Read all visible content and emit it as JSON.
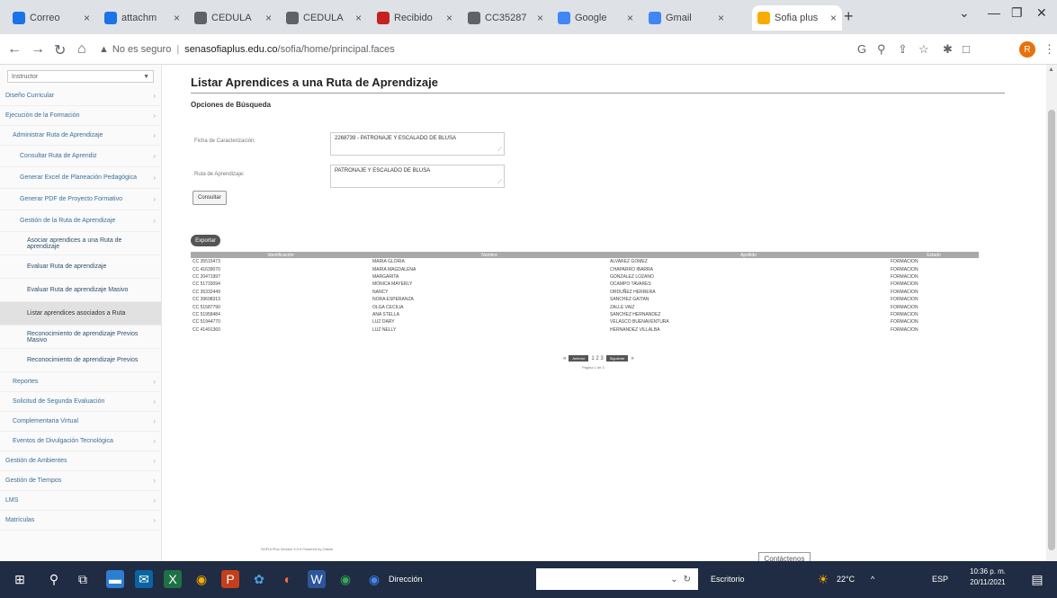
{
  "browser": {
    "tabs": [
      {
        "label": "Correo",
        "color": "#1a73e8"
      },
      {
        "label": "attachm",
        "color": "#1a73e8"
      },
      {
        "label": "CEDULA",
        "color": "#5f6368"
      },
      {
        "label": "CEDULA",
        "color": "#5f6368"
      },
      {
        "label": "Recibido",
        "color": "#c5221f"
      },
      {
        "label": "CC35287",
        "color": "#5f6368"
      },
      {
        "label": "Google",
        "color": "#4285f4"
      },
      {
        "label": "Gmail",
        "color": "#4285f4"
      },
      {
        "label": "Sofia plus",
        "color": "#f9ab00"
      }
    ],
    "url_warning": "No es seguro",
    "url_host": "senasofiaplus.edu.co",
    "url_path": "/sofia/home/principal.faces"
  },
  "sidebar": {
    "select": "Instructor",
    "items": [
      {
        "label": "Diseño Curricular",
        "level": 0
      },
      {
        "label": "Ejecución de la Formación",
        "level": 0
      },
      {
        "label": "Administrar Ruta de Aprendizaje",
        "level": 1
      },
      {
        "label": "Consultar Ruta de Aprendiz",
        "level": 2
      },
      {
        "label": "Generar Excel de Planeación Pedagógica",
        "level": 2
      },
      {
        "label": "Generar PDF de Proyecto Formativo",
        "level": 2
      },
      {
        "label": "Gestión de la Ruta de Aprendizaje",
        "level": 2
      },
      {
        "label": "Asociar aprendices a una Ruta de aprendizaje",
        "level": 3
      },
      {
        "label": "Evaluar Ruta de aprendizaje",
        "level": 3
      },
      {
        "label": "Evaluar Ruta de aprendizaje Masivo",
        "level": 3
      },
      {
        "label": "Listar aprendices asociados a Ruta",
        "level": 3,
        "active": true
      },
      {
        "label": "Reconocimiento de aprendizaje Previos Masivo",
        "level": 3
      },
      {
        "label": "Reconocimiento de aprendizaje Previos",
        "level": 3
      },
      {
        "label": "Reportes",
        "level": 1
      },
      {
        "label": "Solicitud de Segunda Evaluación",
        "level": 1
      },
      {
        "label": "Complementaria Virtual",
        "level": 1
      },
      {
        "label": "Eventos de Divulgación Tecnológica",
        "level": 1
      },
      {
        "label": "Gestión de Ambientes",
        "level": 0
      },
      {
        "label": "Gestión de Tiempos",
        "level": 0
      },
      {
        "label": "LMS",
        "level": 0
      },
      {
        "label": "Matrículas",
        "level": 0
      }
    ]
  },
  "main": {
    "title": "Listar Aprendices a una Ruta de Aprendizaje",
    "section": "Opciones de Búsqueda",
    "ficha_label": "Ficha de Caracterización:",
    "ficha_value": "2268739 - PATRONAJE Y ESCALADO DE BLUSA",
    "ruta_label": "Ruta de Aprendizaje:",
    "ruta_value": "PATRONAJE Y ESCALADO DE BLUSA",
    "consult_button": "Consultar",
    "export_button": "Exportar",
    "columns": [
      "Identificación",
      "Nombre",
      "Apellido",
      "Estado"
    ],
    "rows": [
      [
        "CC 35515473",
        "Maria Gloria",
        "Alvarez Gomez",
        "Formacion"
      ],
      [
        "CC 41639070",
        "Maria Magdalena",
        "Chaparro Ibarra",
        "Formacion"
      ],
      [
        "CC 20471997",
        "Margarita",
        "Gonzalez Lozano",
        "Formacion"
      ],
      [
        "CC 51733094",
        "Mónica Mayerly",
        "Ocampo Tavares",
        "Formacion"
      ],
      [
        "CC 35332449",
        "Nancy",
        "Orduñez Herrera",
        "Formacion"
      ],
      [
        "CC 39698313",
        "Nora Esperanza",
        "Sanchez Gaitan",
        "Formacion"
      ],
      [
        "CC 51587790",
        "Olga Cecilia",
        "Zalle Vaiz",
        "Formacion"
      ],
      [
        "CC 51958484",
        "Ana Stella",
        "Sanchez Hernandez",
        "Formacion"
      ],
      [
        "CC 51944770",
        "Luz Dary",
        "Velasco Buenaventura",
        "Formacion"
      ],
      [
        "CC 41491360",
        "Luz Nelly",
        "Hernandez Villalba",
        "Formacion"
      ]
    ],
    "pager": {
      "prev": "Anterior",
      "pages": "1 2 3",
      "next": "Siguiente",
      "info": "Página 1 de 3"
    }
  },
  "footer": "SOFIA Plus Versión 3.0.0 Powered by Oracle",
  "contacts": "Contáctenos",
  "taskbar": {
    "app_label": "Dirección",
    "search_placeholder": "",
    "sound_label": "Escritorio",
    "weather": "22°C",
    "lang": "ESP",
    "time": "10:36 p. m.",
    "date": "20/11/2021"
  }
}
